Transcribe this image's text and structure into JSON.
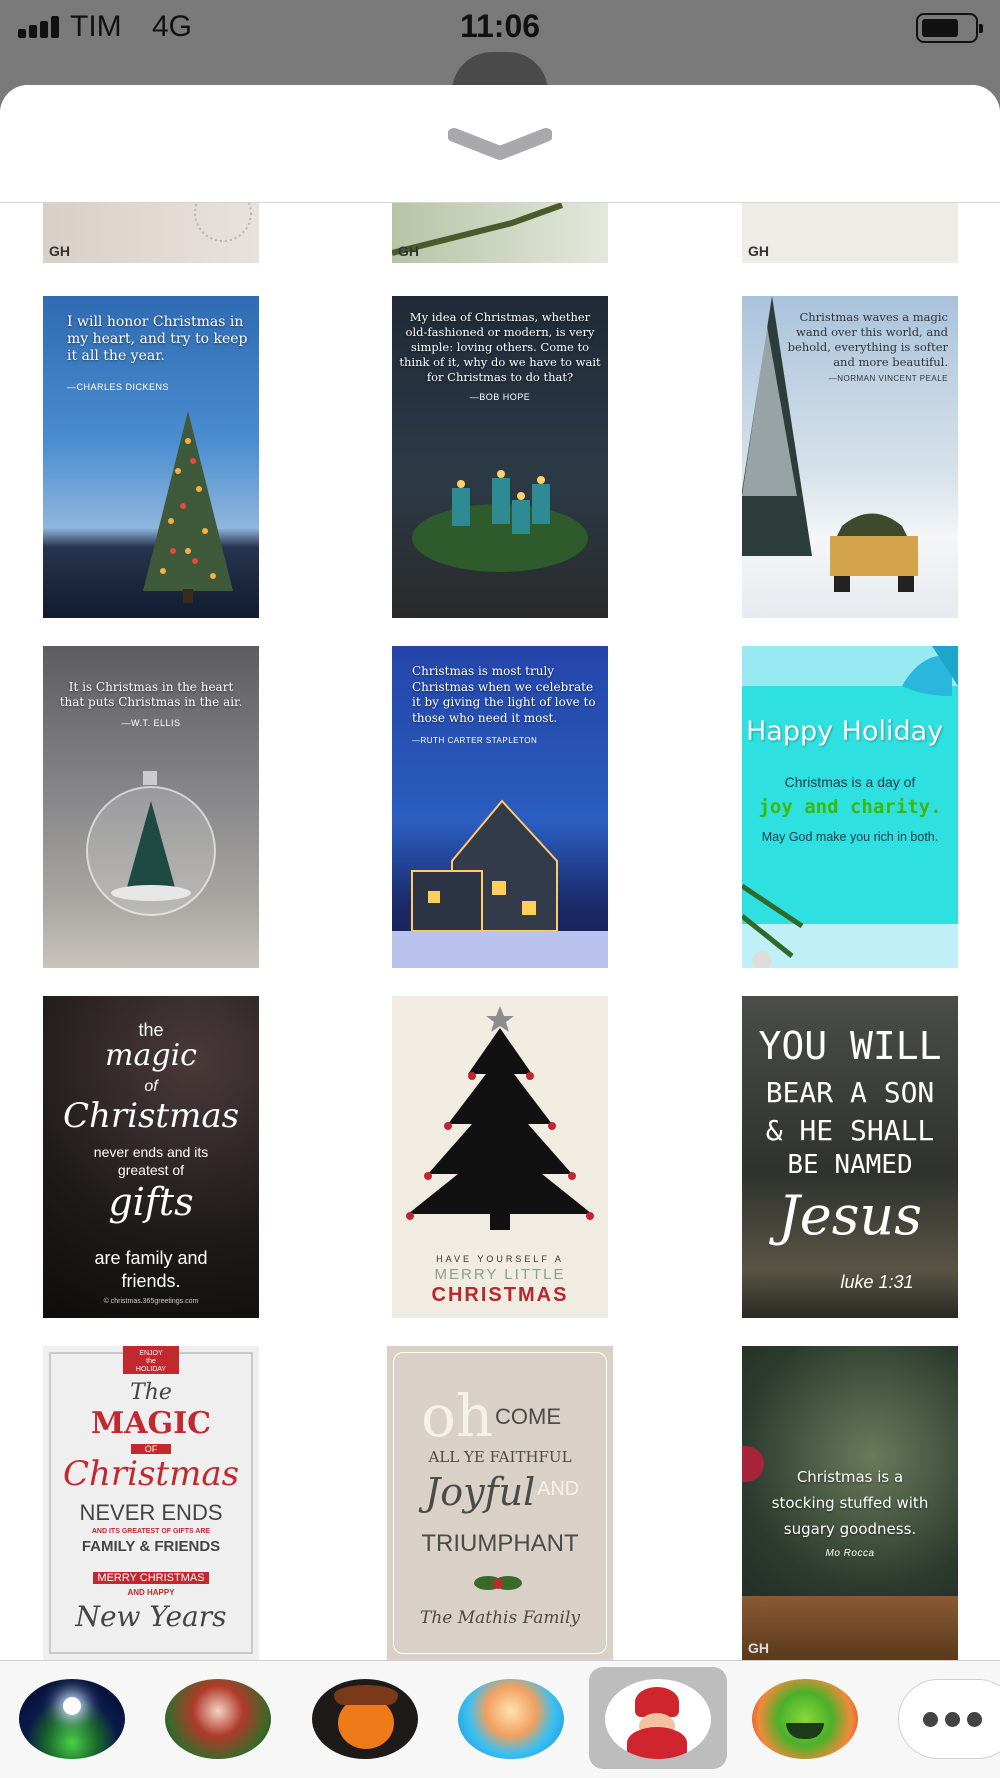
{
  "status_bar": {
    "carrier": "TIM",
    "network": "4G",
    "time": "11:06"
  },
  "cards": {
    "dickens": {
      "quote": "I will honor Christmas in\nmy heart, and try to keep\nit all the year.",
      "author": "—CHARLES DICKENS"
    },
    "hope": {
      "quote": "My idea of Christmas, whether\nold-fashioned or modern, is very\nsimple: loving others. Come to\nthink of it, why do we have to wait\nfor Christmas to do that?",
      "author": "—BOB HOPE"
    },
    "peale": {
      "quote": "Christmas waves a magic\nwand over this world, and\nbehold, everything is softer\nand more beautiful.",
      "author": "—NORMAN VINCENT PEALE"
    },
    "ellis": {
      "quote": "It is Christmas in the heart\nthat puts Christmas in the air.",
      "author": "—W.T. ELLIS"
    },
    "stapleton": {
      "quote": "Christmas is most truly\nChristmas when we celebrate\nit by giving the light of love to\nthose who need it most.",
      "author": "—RUTH CARTER STAPLETON"
    },
    "holiday": {
      "title": "Happy Holiday",
      "line1": "Christmas is a day of",
      "line2": "joy and charity.",
      "line3": "May God make you rich in both."
    },
    "magic": {
      "the": "the",
      "magic": "magic",
      "of": "of",
      "christmas": "Christmas",
      "line1": "never ends and its",
      "line2": "greatest of",
      "gifts": "gifts",
      "line3": "are family and",
      "line4": "friends.",
      "source": "© christmas.365greetings.com"
    },
    "tree": {
      "line1": "HAVE YOURSELF A",
      "line2": "MERRY LITTLE",
      "line3": "CHRISTMAS"
    },
    "son": {
      "l1": "YOU WILL",
      "l2": "BEAR A SON",
      "l3": "& HE SHALL",
      "l4": "BE NAMED",
      "l5": "Jesus",
      "ref": "luke 1:31"
    },
    "poster": {
      "tag1": "ENJOY",
      "tag2": "the",
      "tag3": "HOLIDAY",
      "the": "The",
      "magic": "MAGIC",
      "of": "OF",
      "christmas": "Christmas",
      "never": "NEVER ENDS",
      "small": "AND ITS GREATEST OF GIFTS ARE",
      "family": "FAMILY & FRIENDS",
      "merry": "MERRY CHRISTMAS",
      "and": "AND HAPPY",
      "ny": "New Years"
    },
    "ohcome": {
      "oh": "oh",
      "come": "COME",
      "faithful": "ALL YE FAITHFUL",
      "joyful": "Joyful",
      "and": "AND",
      "triumphant": "TRIUMPHANT",
      "family": "The Mathis Family"
    },
    "rocca": {
      "quote": "Christmas is a\nstocking stuffed with\nsugary goodness.",
      "author": "Mo Rocca"
    },
    "gh": "GH"
  },
  "tray": {
    "more": "•••"
  },
  "colors": {
    "status_bg": "#7a7a7a",
    "sheet_bg": "#ffffff",
    "tray_bg": "#f7f7f7",
    "selected": "#bdbdbd"
  }
}
